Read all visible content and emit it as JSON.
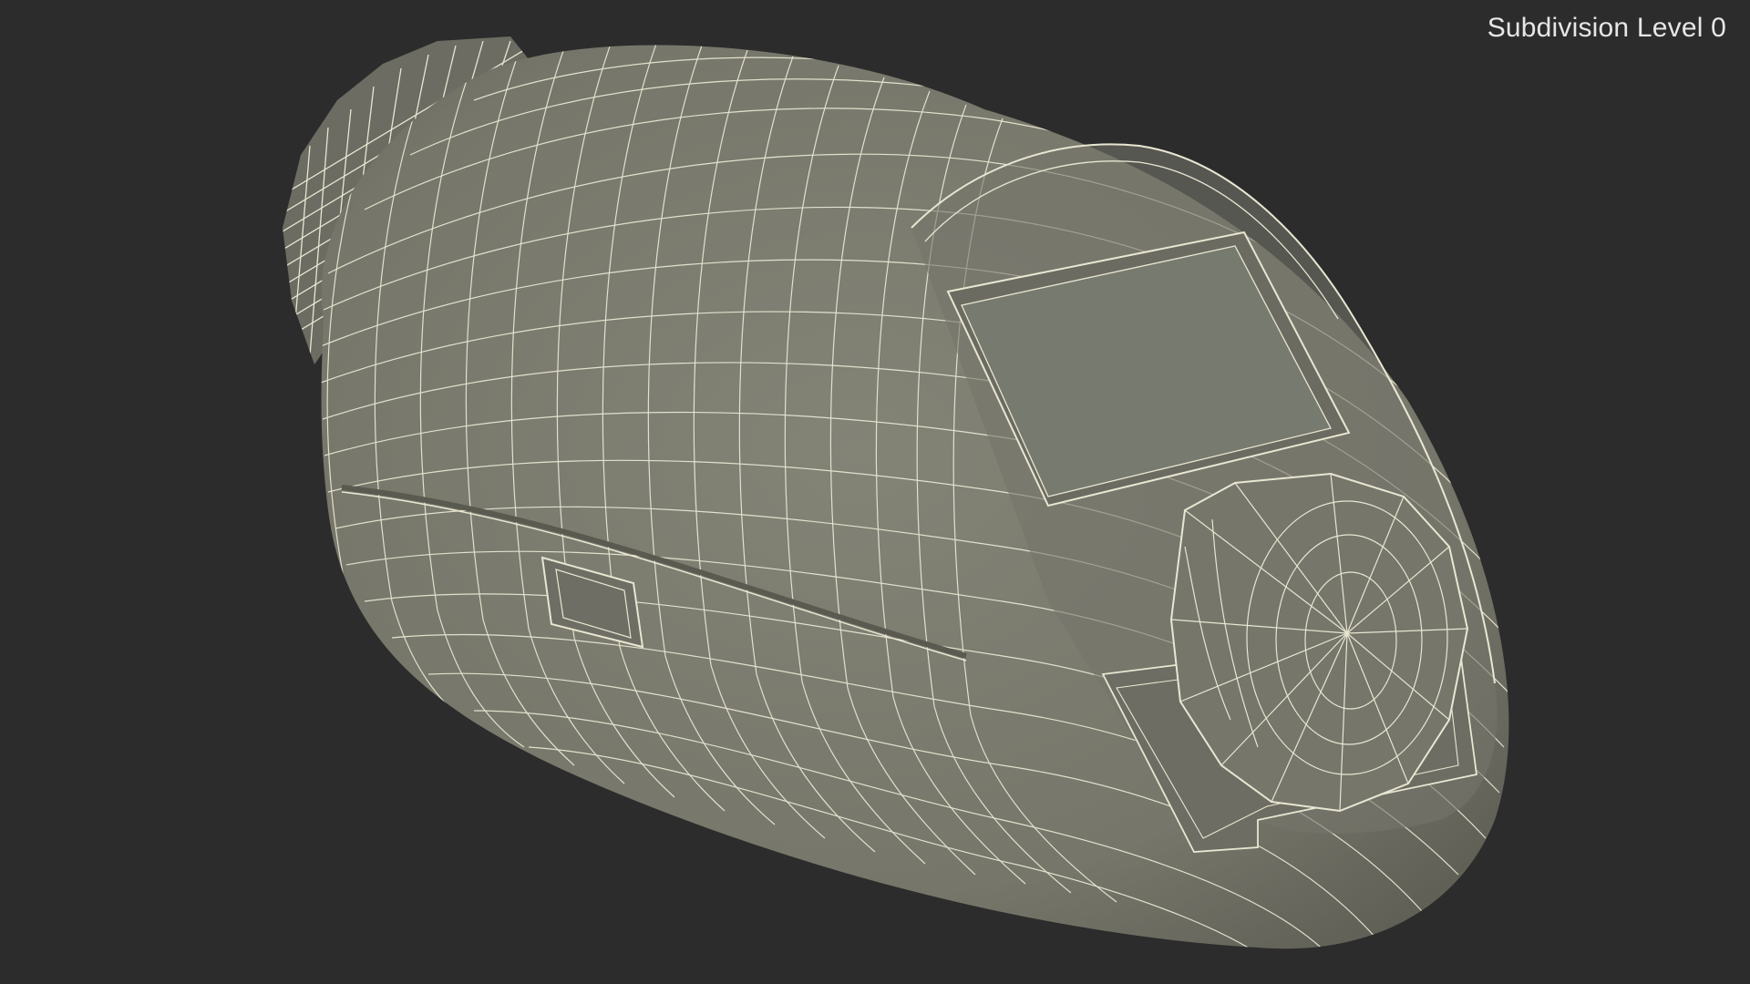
{
  "viewport": {
    "overlay_label": "Subdivision Level 0",
    "background_color": "#2c2c2c",
    "label_color": "#e6e6e6"
  },
  "model": {
    "description_icon": "thermostat-wireframe",
    "surface_color": "#7a7a6e",
    "shadow_color": "#5e5e54",
    "wire_color": "#e9e6d2",
    "screen_color": "#777a6e"
  }
}
